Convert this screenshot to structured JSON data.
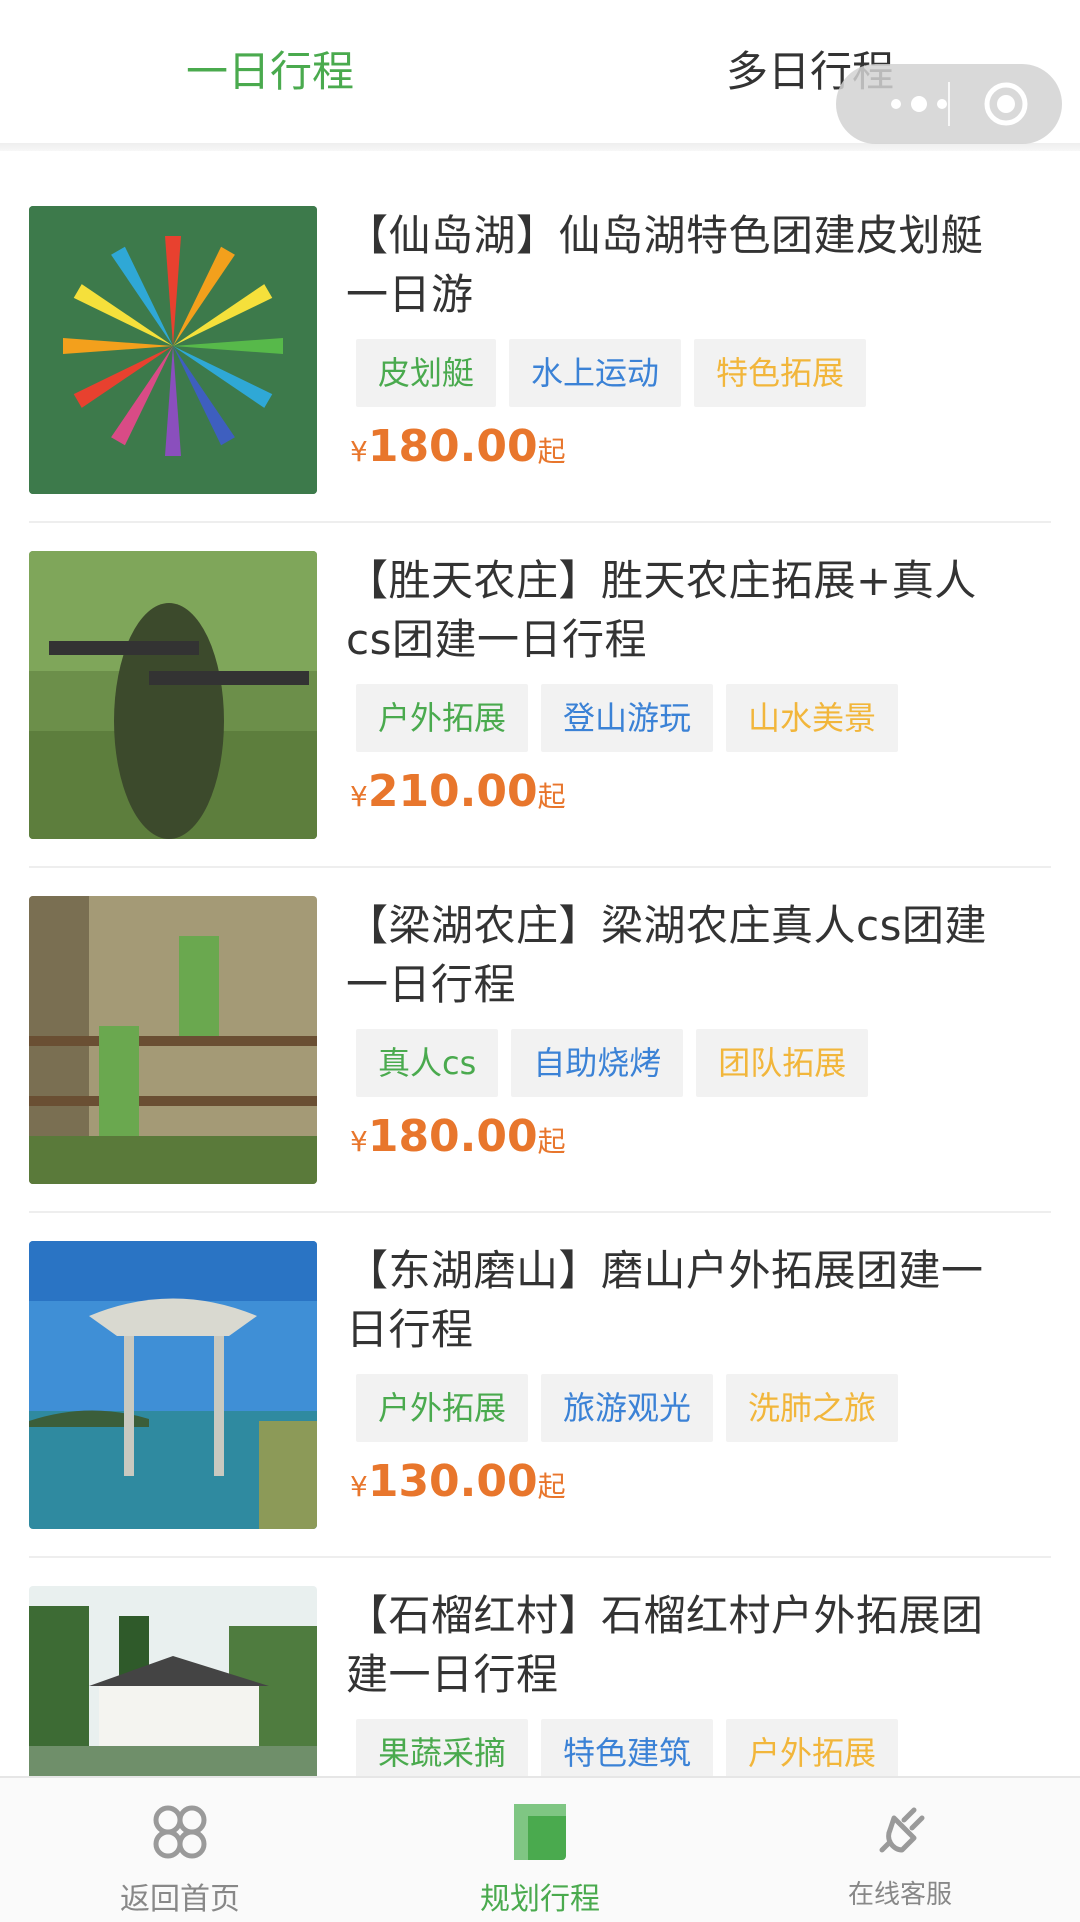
{
  "tabs": {
    "one_day": "一日行程",
    "multi_day": "多日行程",
    "active": "one_day"
  },
  "colors": {
    "accent_green": "#4aaa4e",
    "tag_blue": "#3b82d6",
    "tag_yellow": "#f2b63b",
    "price_orange": "#e8762c"
  },
  "items": [
    {
      "title": "【仙岛湖】仙岛湖特色团建皮划艇一日游",
      "tags": [
        {
          "label": "皮划艇",
          "color": "green"
        },
        {
          "label": "水上运动",
          "color": "blue"
        },
        {
          "label": "特色拓展",
          "color": "yellow"
        }
      ],
      "price_symbol": "¥",
      "price": "180.00",
      "price_suffix": "起"
    },
    {
      "title": "【胜天农庄】胜天农庄拓展+真人cs团建一日行程",
      "tags": [
        {
          "label": "户外拓展",
          "color": "green"
        },
        {
          "label": "登山游玩",
          "color": "blue"
        },
        {
          "label": "山水美景",
          "color": "yellow"
        }
      ],
      "price_symbol": "¥",
      "price": "210.00",
      "price_suffix": "起"
    },
    {
      "title": "【梁湖农庄】梁湖农庄真人cs团建一日行程",
      "tags": [
        {
          "label": "真人cs",
          "color": "green"
        },
        {
          "label": "自助烧烤",
          "color": "blue"
        },
        {
          "label": "团队拓展",
          "color": "yellow"
        }
      ],
      "price_symbol": "¥",
      "price": "180.00",
      "price_suffix": "起"
    },
    {
      "title": "【东湖磨山】磨山户外拓展团建一日行程",
      "tags": [
        {
          "label": "户外拓展",
          "color": "green"
        },
        {
          "label": "旅游观光",
          "color": "blue"
        },
        {
          "label": "洗肺之旅",
          "color": "yellow"
        }
      ],
      "price_symbol": "¥",
      "price": "130.00",
      "price_suffix": "起"
    },
    {
      "title": "【石榴红村】石榴红村户外拓展团建一日行程",
      "tags": [
        {
          "label": "果蔬采摘",
          "color": "green"
        },
        {
          "label": "特色建筑",
          "color": "blue"
        },
        {
          "label": "户外拓展",
          "color": "yellow"
        }
      ],
      "price_symbol": "¥",
      "price": "",
      "price_suffix": ""
    }
  ],
  "tabbar": [
    {
      "label": "返回首页",
      "icon": "home-grid-icon",
      "active": false
    },
    {
      "label": "规划行程",
      "icon": "plan-icon",
      "active": true
    },
    {
      "label": "在线客服",
      "icon": "service-plug-icon",
      "active": false
    }
  ]
}
